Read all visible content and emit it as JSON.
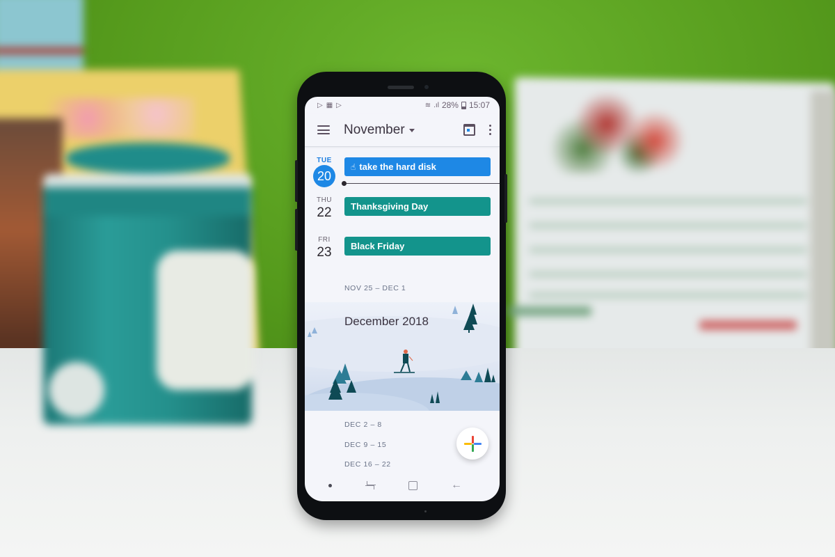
{
  "statusbar": {
    "notification_icons": [
      "play-store-icon",
      "photos-icon",
      "play-icon"
    ],
    "signal_icons": [
      "wifi-icon",
      "cell-signal-icon"
    ],
    "battery": "28%",
    "time": "15:07"
  },
  "appbar": {
    "menu_icon": "hamburger-icon",
    "month": "November",
    "today_icon": "calendar-today-icon",
    "more_icon": "more-vert-icon"
  },
  "agenda": {
    "days": [
      {
        "dow": "TUE",
        "dom": "20",
        "today": true,
        "event": {
          "title": "take the hard disk",
          "icon": "hand-icon",
          "color": "#1e88e5"
        }
      },
      {
        "dow": "THU",
        "dom": "22",
        "today": false,
        "event": {
          "title": "Thanksgiving Day",
          "color": "#13948c"
        }
      },
      {
        "dow": "FRI",
        "dom": "23",
        "today": false,
        "event": {
          "title": "Black Friday",
          "color": "#13948c"
        }
      }
    ],
    "week_after": "NOV 25 – DEC 1",
    "month_banner": "December 2018",
    "weeks": [
      "DEC 2 – 8",
      "DEC 9 – 15",
      "DEC 16 – 22"
    ]
  },
  "fab": {
    "icon": "add-icon",
    "colors": [
      "#ea4335",
      "#4285f4",
      "#34a853",
      "#fbbc05"
    ]
  },
  "navbar": {
    "items": [
      "indicator-dot",
      "recent-apps-icon",
      "home-icon",
      "back-icon"
    ]
  }
}
